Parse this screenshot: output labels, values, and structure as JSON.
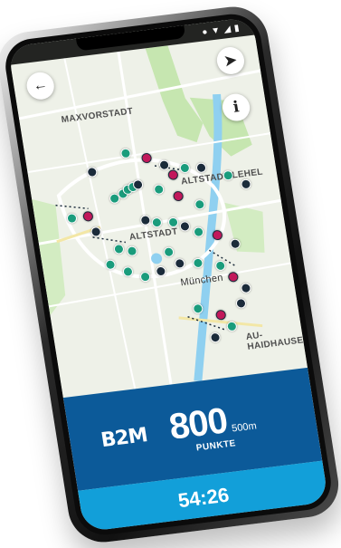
{
  "map": {
    "labels": {
      "maxvorstadt": "MAXVORSTADT",
      "altstadt_lehel": "ALTSTADT-LEHEL",
      "altstadt": "ALTSTADT",
      "munchen": "München",
      "au_haidhausen": "AU-HAIDHAUSE"
    },
    "colors": {
      "park": "#c6e6b0",
      "river": "#8fd0f0",
      "road": "#ffffff",
      "marker_teal": "#1a9c7c",
      "marker_dark": "#1b2b3a",
      "marker_pink": "#c2185b"
    }
  },
  "controls": {
    "back_icon": "arrow-left",
    "locate_icon": "navigation-arrow",
    "info_label": "i"
  },
  "score_panel": {
    "logo": "B2M",
    "points": "800",
    "distance": "500m",
    "points_label": "PUNKTE",
    "color": "#0c5a99"
  },
  "timer": {
    "value": "54:26",
    "color": "#129fd9"
  }
}
